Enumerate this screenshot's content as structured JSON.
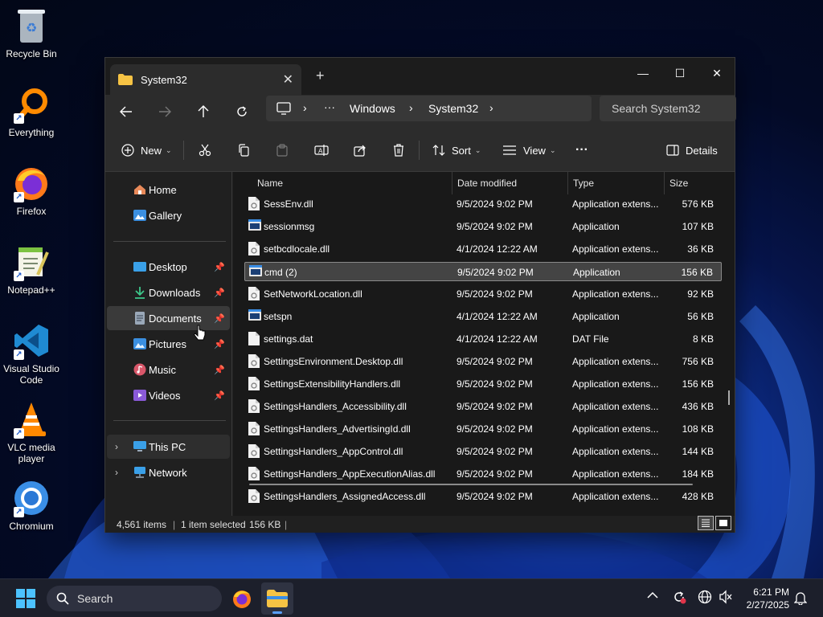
{
  "desktop": {
    "icons": [
      {
        "label": "Recycle Bin",
        "icon": "recycle-bin-icon"
      },
      {
        "label": "Everything",
        "icon": "everything-search-icon"
      },
      {
        "label": "Firefox",
        "icon": "firefox-icon"
      },
      {
        "label": "Notepad++",
        "icon": "notepadpp-icon"
      },
      {
        "label": "Visual Studio Code",
        "icon": "vscode-icon"
      },
      {
        "label": "VLC media player",
        "icon": "vlc-icon"
      },
      {
        "label": "Chromium",
        "icon": "chromium-icon"
      }
    ]
  },
  "window": {
    "tab_title": "System32",
    "tab_close": "✕",
    "new_tab": "+",
    "controls": {
      "minimize": "—",
      "maximize": "☐",
      "close": "✕"
    },
    "address": {
      "more": "···",
      "crumbs": [
        "Windows",
        "System32"
      ],
      "separator": "›"
    },
    "search_placeholder": "Search System32",
    "commandbar": {
      "new_label": "New",
      "sort_label": "Sort",
      "view_label": "View",
      "more": "···",
      "details_label": "Details"
    },
    "nav": {
      "home": "Home",
      "gallery": "Gallery",
      "desktop": "Desktop",
      "downloads": "Downloads",
      "documents": "Documents",
      "pictures": "Pictures",
      "music": "Music",
      "videos": "Videos",
      "this_pc": "This PC",
      "network": "Network"
    },
    "columns": {
      "name": "Name",
      "date": "Date modified",
      "type": "Type",
      "size": "Size"
    },
    "files": [
      {
        "name": "SessEnv.dll",
        "date": "9/5/2024 9:02 PM",
        "type": "Application extens...",
        "size": "576 KB",
        "kind": "dll"
      },
      {
        "name": "sessionmsg",
        "date": "9/5/2024 9:02 PM",
        "type": "Application",
        "size": "107 KB",
        "kind": "exe"
      },
      {
        "name": "setbcdlocale.dll",
        "date": "4/1/2024 12:22 AM",
        "type": "Application extens...",
        "size": "36 KB",
        "kind": "dll"
      },
      {
        "name": "cmd (2)",
        "date": "9/5/2024 9:02 PM",
        "type": "Application",
        "size": "156 KB",
        "kind": "exe",
        "selected": true
      },
      {
        "name": "SetNetworkLocation.dll",
        "date": "9/5/2024 9:02 PM",
        "type": "Application extens...",
        "size": "92 KB",
        "kind": "dll"
      },
      {
        "name": "setspn",
        "date": "4/1/2024 12:22 AM",
        "type": "Application",
        "size": "56 KB",
        "kind": "exe"
      },
      {
        "name": "settings.dat",
        "date": "4/1/2024 12:22 AM",
        "type": "DAT File",
        "size": "8 KB",
        "kind": "file"
      },
      {
        "name": "SettingsEnvironment.Desktop.dll",
        "date": "9/5/2024 9:02 PM",
        "type": "Application extens...",
        "size": "756 KB",
        "kind": "dll"
      },
      {
        "name": "SettingsExtensibilityHandlers.dll",
        "date": "9/5/2024 9:02 PM",
        "type": "Application extens...",
        "size": "156 KB",
        "kind": "dll"
      },
      {
        "name": "SettingsHandlers_Accessibility.dll",
        "date": "9/5/2024 9:02 PM",
        "type": "Application extens...",
        "size": "436 KB",
        "kind": "dll"
      },
      {
        "name": "SettingsHandlers_AdvertisingId.dll",
        "date": "9/5/2024 9:02 PM",
        "type": "Application extens...",
        "size": "108 KB",
        "kind": "dll"
      },
      {
        "name": "SettingsHandlers_AppControl.dll",
        "date": "9/5/2024 9:02 PM",
        "type": "Application extens...",
        "size": "144 KB",
        "kind": "dll"
      },
      {
        "name": "SettingsHandlers_AppExecutionAlias.dll",
        "date": "9/5/2024 9:02 PM",
        "type": "Application extens...",
        "size": "184 KB",
        "kind": "dll"
      },
      {
        "name": "SettingsHandlers_AssignedAccess.dll",
        "date": "9/5/2024 9:02 PM",
        "type": "Application extens...",
        "size": "428 KB",
        "kind": "dll"
      }
    ],
    "status": {
      "items": "4,561 items",
      "selected": "1 item selected",
      "size": "156 KB",
      "sep": "|"
    }
  },
  "taskbar": {
    "search_label": "Search",
    "time": "6:21 PM",
    "date": "2/27/2025"
  },
  "colors": {
    "window_bg": "#202020",
    "accent": "#5aa0ff",
    "folder_yellow": "#f6c344"
  }
}
